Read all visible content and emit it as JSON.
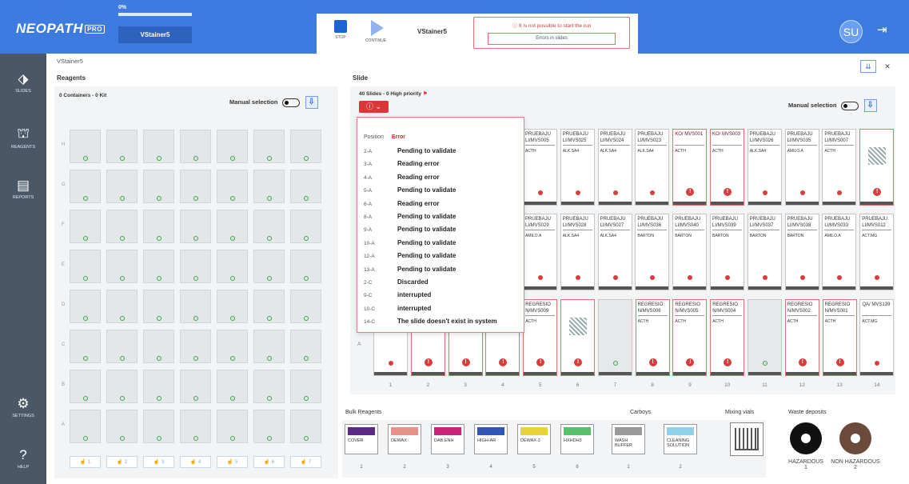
{
  "app": {
    "logo": "NEOPATH",
    "logo_badge": "PRO"
  },
  "progress": {
    "percent_label": "0%",
    "value": 0
  },
  "stainer_button": "VStainer5",
  "run": {
    "stop_label": "STOP",
    "continue_label": "CONTINUE",
    "stainer_name": "VStainer5",
    "warning_title": "It is not possible to start the run",
    "warning_detail": "Errors in slides"
  },
  "user": {
    "initials": "SU"
  },
  "sidebar": {
    "items": [
      {
        "label": "SLIDES"
      },
      {
        "label": "REAGENTS"
      },
      {
        "label": "REPORTS"
      },
      {
        "label": "SETTINGS"
      },
      {
        "label": "HELP"
      }
    ]
  },
  "breadcrumb": "VStainer5",
  "reagents": {
    "title": "Reagents",
    "summary": "0 Containers - 0 Kit",
    "manual_selection": "Manual selection",
    "rows": [
      "H",
      "G",
      "F",
      "E",
      "D",
      "C",
      "B",
      "A"
    ],
    "positions": [
      "1",
      "2",
      "3",
      "4",
      "5",
      "6",
      "7"
    ]
  },
  "slide": {
    "title": "Slide",
    "summary": "40 Slides - 0 High priority",
    "manual_selection": "Manual selection",
    "row_a_label": "A",
    "columns": [
      "1",
      "2",
      "3",
      "4",
      "5",
      "6",
      "7",
      "8",
      "9",
      "10",
      "11",
      "12",
      "13",
      "14"
    ],
    "row1": [
      {
        "name": "PRUEBAJU LI/MVS005",
        "reagent": "ACTH",
        "status": "dot"
      },
      {
        "name": "PRUEBAJU LI/MVS025",
        "reagent": "ALK.SA4",
        "status": "dot"
      },
      {
        "name": "PRUEBAJU LI/MVS024",
        "reagent": "ALK.SA4",
        "status": "dot"
      },
      {
        "name": "PRUEBAJU LI/MVS023",
        "reagent": "ALK.SA4",
        "status": "dot"
      },
      {
        "name": "KO/ MVS001",
        "reagent": "ACTH",
        "status": "error"
      },
      {
        "name": "KO/ MVS003",
        "reagent": "ACTH",
        "status": "error"
      },
      {
        "name": "PRUEBAJU LI/MVS026",
        "reagent": "ALK.SA4",
        "status": "dot"
      },
      {
        "name": "PRUEBAJU LI/MVS035",
        "reagent": "AMILO.A",
        "status": "dot"
      },
      {
        "name": "PRUEBAJU LI/MVS007",
        "reagent": "ACTH",
        "status": "dot"
      },
      {
        "name": "",
        "reagent": "",
        "status": "qr-error"
      }
    ],
    "row2": [
      {
        "name": "PRUEBAJU LI/MVS029",
        "reagent": "AMILO.A"
      },
      {
        "name": "PRUEBAJU LI/MVS028",
        "reagent": "ALK.SA4"
      },
      {
        "name": "PRUEBAJU LI/MVS027",
        "reagent": "ALK.SA4"
      },
      {
        "name": "PRUEBAJU LI/MVS036",
        "reagent": "BARTON"
      },
      {
        "name": "PRUEBAJU LI/MVS040",
        "reagent": "BARTON"
      },
      {
        "name": "PRUEBAJU LI/MVS039",
        "reagent": "BARTON"
      },
      {
        "name": "PRUEBAJU LI/MVS037",
        "reagent": "BARTON"
      },
      {
        "name": "PRUEBAJU LI/MVS038",
        "reagent": "BARTON"
      },
      {
        "name": "PRUEBAJU LI/MVS033",
        "reagent": "AMILO.A"
      },
      {
        "name": "PRUEBAJU LI/MVS012",
        "reagent": "ACT.MG"
      }
    ],
    "row3": [
      {
        "name": "",
        "reagent": "AMILO.A",
        "status": "dot"
      },
      {
        "name": "",
        "reagent": "AMILO.A",
        "status": "error"
      },
      {
        "name": "",
        "reagent": "",
        "status": "error"
      },
      {
        "name": "",
        "reagent": "",
        "status": "error"
      },
      {
        "name": "REGRESIO N/MVS009",
        "reagent": "ACTH",
        "status": "error"
      },
      {
        "name": "",
        "reagent": "",
        "status": "qr-error"
      },
      {
        "name": "",
        "reagent": "",
        "status": "empty"
      },
      {
        "name": "REGRESIO N/MVS006",
        "reagent": "ACTH",
        "status": "error"
      },
      {
        "name": "REGRESIO N/MVS005",
        "reagent": "ACTH",
        "status": "error"
      },
      {
        "name": "REGRESIO N/MVS004",
        "reagent": "ACTH",
        "status": "error"
      },
      {
        "name": "",
        "reagent": "",
        "status": "empty"
      },
      {
        "name": "REGRESIO N/MVS002",
        "reagent": "ACTH",
        "status": "error"
      },
      {
        "name": "REGRESIO N/MVS001",
        "reagent": "ACTH",
        "status": "error"
      },
      {
        "name": "QA/ MVS139",
        "reagent": "ACT.MG",
        "status": "dot"
      }
    ]
  },
  "error_dropdown": {
    "col_position": "Position",
    "col_error": "Error",
    "rows": [
      {
        "position": "2-A",
        "error": "Pending to validate"
      },
      {
        "position": "3-A",
        "error": "Reading error"
      },
      {
        "position": "4-A",
        "error": "Reading error"
      },
      {
        "position": "5-A",
        "error": "Pending to validate"
      },
      {
        "position": "6-A",
        "error": "Reading error"
      },
      {
        "position": "8-A",
        "error": "Pending to validate"
      },
      {
        "position": "9-A",
        "error": "Pending to validate"
      },
      {
        "position": "10-A",
        "error": "Pending to validate"
      },
      {
        "position": "12-A",
        "error": "Pending to validate"
      },
      {
        "position": "13-A",
        "error": "Pending to validate"
      },
      {
        "position": "2-C",
        "error": "Discarded"
      },
      {
        "position": "9-C",
        "error": "interrupted"
      },
      {
        "position": "10-C",
        "error": "interrupted"
      },
      {
        "position": "14-C",
        "error": "The slide doesn't exist in system"
      }
    ]
  },
  "bulk_reagents": {
    "title": "Bulk Reagents",
    "items": [
      {
        "name": "COVER",
        "num": "1",
        "color": "#5b2a86"
      },
      {
        "name": "DEWAX",
        "num": "2",
        "color": "#e8908a"
      },
      {
        "name": "DAB.ENH",
        "num": "3",
        "color": "#c8247a"
      },
      {
        "name": "HIGH-AR",
        "num": "4",
        "color": "#3057b8"
      },
      {
        "name": "DEWAX-2",
        "num": "5",
        "color": "#e6d23a"
      },
      {
        "name": "HXHDH3",
        "num": "6",
        "color": "#57c06a"
      }
    ]
  },
  "carboys": {
    "title": "Carboys",
    "items": [
      {
        "name": "WASH BUFFER",
        "num": "1",
        "color": "#9a9a9a"
      },
      {
        "name": "CLEANING SOLUTION",
        "num": "2",
        "color": "#8fd2e8"
      }
    ]
  },
  "mixing_vials": {
    "title": "Mixing vials"
  },
  "waste": {
    "title": "Waste deposits",
    "items": [
      {
        "name": "HAZARDOUS",
        "num": "1",
        "color": "#111111"
      },
      {
        "name": "NON HAZARDOUS",
        "num": "2",
        "color": "#6b4a3a"
      }
    ]
  }
}
